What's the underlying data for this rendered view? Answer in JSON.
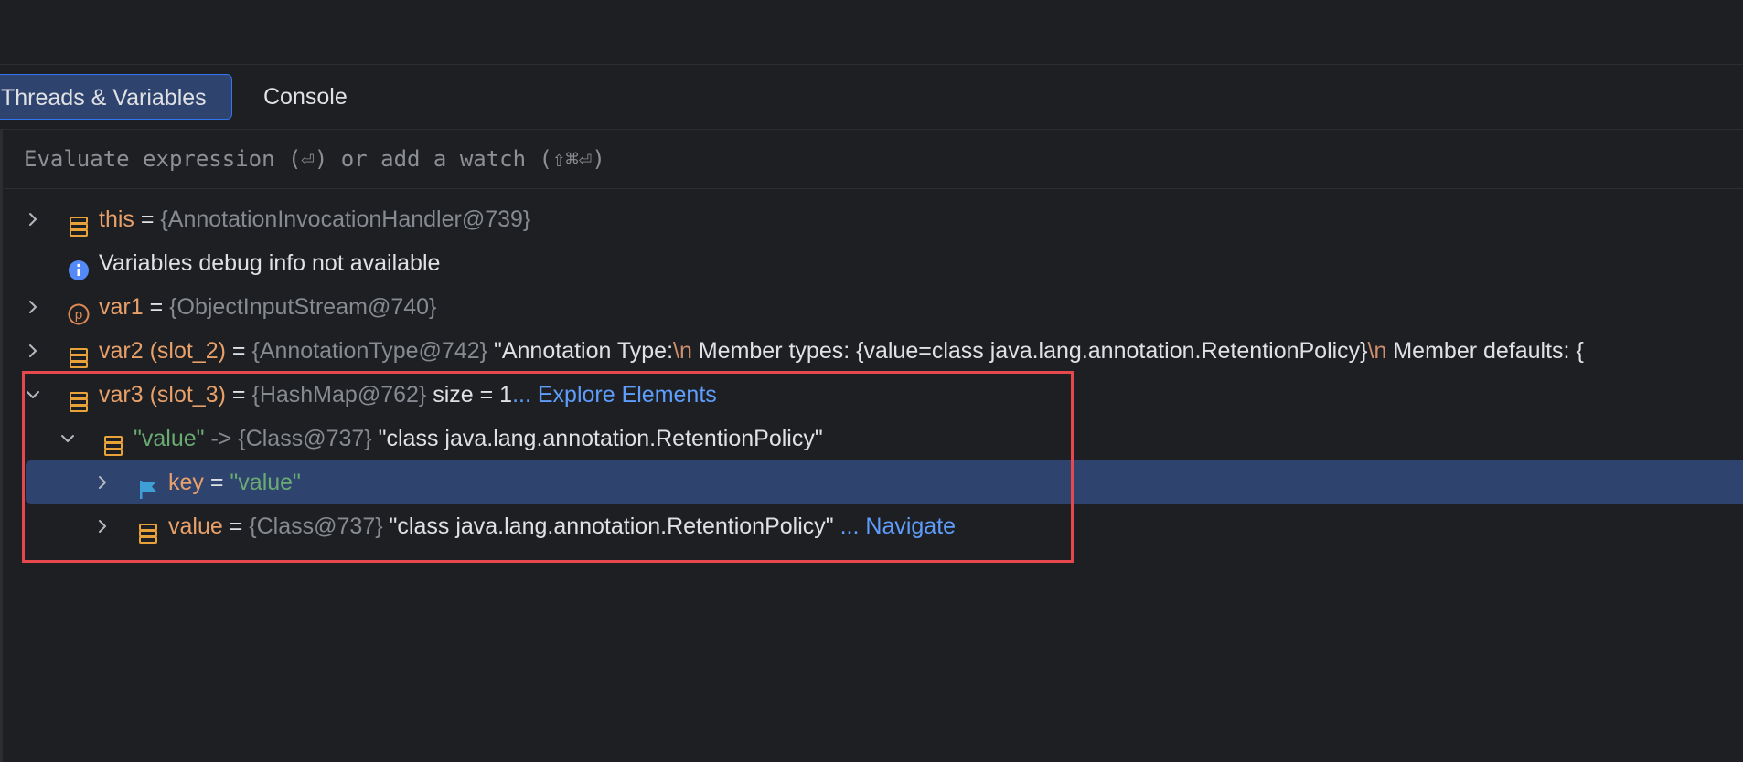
{
  "tabs": {
    "threads_variables": "Threads & Variables",
    "console": "Console"
  },
  "evaluate": {
    "placeholder": "Evaluate expression (⏎) or add a watch (⇧⌘⏎)"
  },
  "variables": {
    "this": {
      "name": "this",
      "eq": "=",
      "value": "{AnnotationInvocationHandler@739}"
    },
    "info": {
      "text": "Variables debug info not available"
    },
    "var1": {
      "name": "var1",
      "eq": "=",
      "value": "{ObjectInputStream@740}"
    },
    "var2": {
      "name": "var2 (slot_2)",
      "eq": "=",
      "ref": "{AnnotationType@742}",
      "str_a": "\"Annotation Type:",
      "esc_a": "\\n",
      "str_b": "  Member types: {value=class java.lang.annotation.RetentionPolicy}",
      "esc_b": "\\n",
      "str_c": "  Member defaults: {"
    },
    "var3": {
      "name": "var3 (slot_3)",
      "eq": "=",
      "ref": "{HashMap@762}",
      "size": " size = 1",
      "link": "... Explore Elements"
    },
    "entry": {
      "key_str": "\"value\"",
      "arrow": " -> ",
      "ref": "{Class@737}",
      "str": "\"class java.lang.annotation.RetentionPolicy\""
    },
    "key": {
      "name": "key",
      "eq": "=",
      "value": "\"value\""
    },
    "value": {
      "name": "value",
      "eq": "=",
      "ref": "{Class@737}",
      "str": "\"class java.lang.annotation.RetentionPolicy\"",
      "link": "... Navigate"
    }
  },
  "colors": {
    "background": "#1e1f22",
    "selection": "#2e436e",
    "accent": "#3574f0",
    "highlight_border": "#e5484d",
    "variable_name": "#e8a06a",
    "string": "#6aab73",
    "link": "#5e9dfc"
  }
}
